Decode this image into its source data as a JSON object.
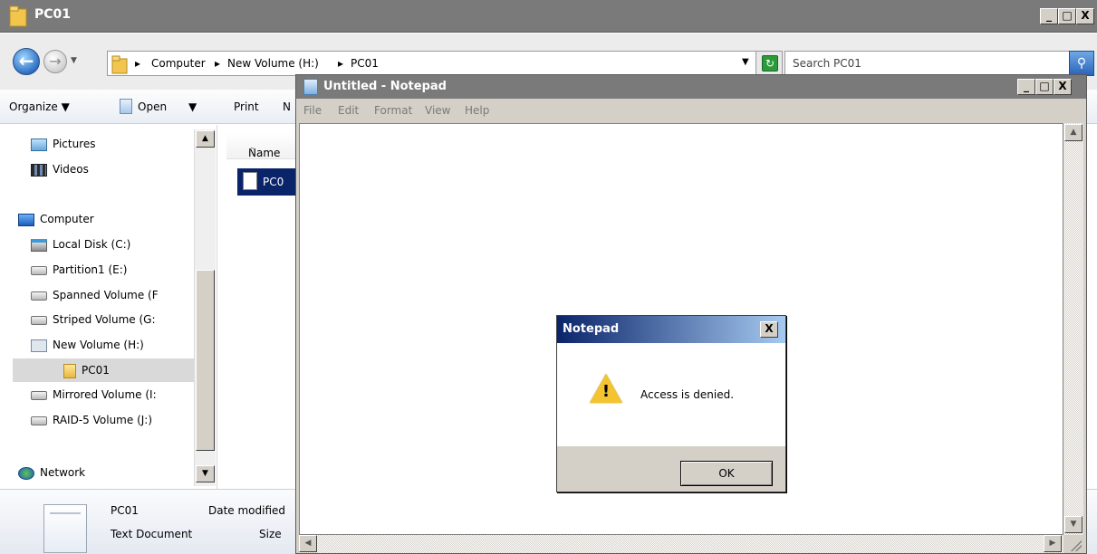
{
  "explorer": {
    "title": "PC01",
    "window_buttons": [
      "_",
      "□",
      "X"
    ],
    "address": {
      "crumbs": [
        "Computer",
        "New Volume (H:)",
        "PC01"
      ]
    },
    "search_placeholder": "Search PC01",
    "toolbar": {
      "organize": "Organize ▼",
      "open": "Open",
      "open_drop": "▼",
      "print": "Print",
      "cut_off": "N"
    },
    "nav": {
      "items": [
        {
          "label": "Pictures",
          "icon": "pictures-icon"
        },
        {
          "label": "Videos",
          "icon": "videos-icon"
        },
        {
          "label": "Computer",
          "icon": "computer-icon"
        },
        {
          "label": "Local Disk (C:)",
          "icon": "local-disk-icon"
        },
        {
          "label": "Partition1 (E:)",
          "icon": "drive-icon"
        },
        {
          "label": "Spanned Volume (F",
          "icon": "drive-icon"
        },
        {
          "label": "Striped Volume (G:",
          "icon": "drive-icon"
        },
        {
          "label": "New Volume (H:)",
          "icon": "mounted-volume-icon"
        },
        {
          "label": "PC01",
          "icon": "folder-icon"
        },
        {
          "label": "Mirrored Volume (I:",
          "icon": "drive-icon"
        },
        {
          "label": "RAID-5 Volume (J:)",
          "icon": "drive-icon"
        },
        {
          "label": "Network",
          "icon": "network-icon"
        }
      ]
    },
    "filelist": {
      "column_name": "Name",
      "sort_arrow": "^",
      "file": "PC0"
    },
    "details": {
      "name": "PC01",
      "type": "Text Document",
      "date_label": "Date modified",
      "size_label": "Size"
    }
  },
  "notepad": {
    "title": "Untitled - Notepad",
    "window_buttons": [
      "_",
      "□",
      "X"
    ],
    "menu": [
      "File",
      "Edit",
      "Format",
      "View",
      "Help"
    ]
  },
  "dialog": {
    "title": "Notepad",
    "close": "X",
    "message": "Access is denied.",
    "ok": "OK"
  },
  "colors": {
    "titlebar": "#7a7a7a",
    "dialog_title": "#0a246a",
    "selection": "#0a246a"
  }
}
